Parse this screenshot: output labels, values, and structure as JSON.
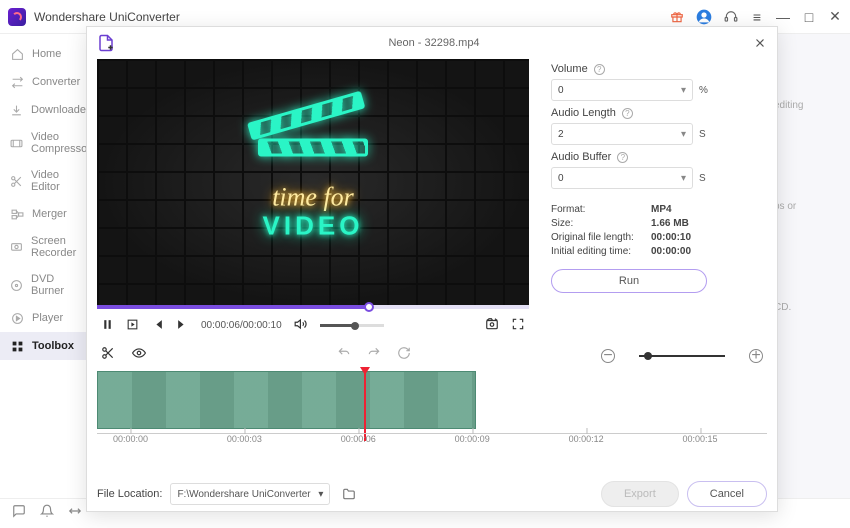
{
  "app": {
    "title": "Wondershare UniConverter"
  },
  "sidebar": {
    "items": [
      {
        "label": "Home"
      },
      {
        "label": "Converter"
      },
      {
        "label": "Downloader"
      },
      {
        "label": "Video Compressor"
      },
      {
        "label": "Video Editor"
      },
      {
        "label": "Merger"
      },
      {
        "label": "Screen Recorder"
      },
      {
        "label": "DVD Burner"
      },
      {
        "label": "Player"
      },
      {
        "label": "Toolbox"
      }
    ]
  },
  "bg_hints": [
    "editing",
    "ps or",
    "CD."
  ],
  "modal": {
    "title": "Neon - 32298.mp4",
    "preview": {
      "line1": "time for",
      "line2": "VIDEO"
    },
    "time": {
      "current": "00:00:06",
      "total": "00:00:10"
    },
    "settings": {
      "volume": {
        "label": "Volume",
        "value": "0",
        "unit": "%"
      },
      "audio_length": {
        "label": "Audio Length",
        "value": "2",
        "unit": "S"
      },
      "audio_buffer": {
        "label": "Audio Buffer",
        "value": "0",
        "unit": "S"
      },
      "info": {
        "format_k": "Format:",
        "format_v": "MP4",
        "size_k": "Size:",
        "size_v": "1.66 MB",
        "origlen_k": "Original file length:",
        "origlen_v": "00:00:10",
        "edittime_k": "Initial editing time:",
        "edittime_v": "00:00:00"
      },
      "run": "Run"
    },
    "ticks": [
      "00:00:00",
      "00:00:03",
      "00:00:06",
      "00:00:09",
      "00:00:12",
      "00:00:15"
    ],
    "file_location": {
      "label": "File Location:",
      "path": "F:\\Wondershare UniConverter"
    },
    "buttons": {
      "export": "Export",
      "cancel": "Cancel"
    }
  }
}
